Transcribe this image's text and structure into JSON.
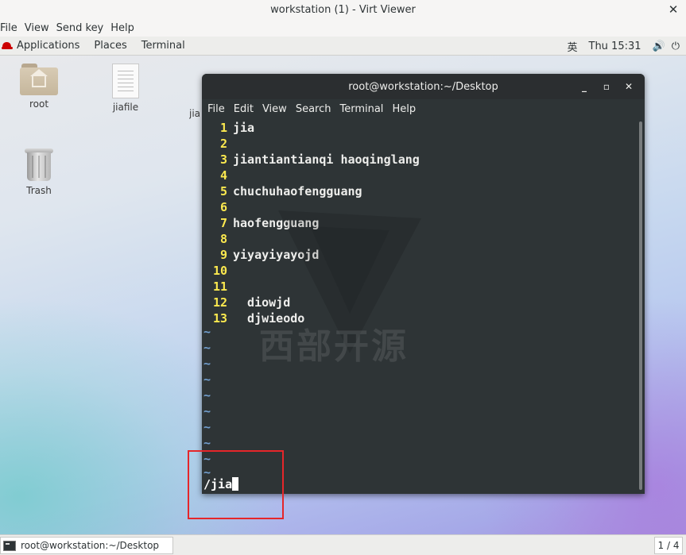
{
  "window": {
    "title": "workstation (1) - Virt Viewer",
    "close_glyph": "✕"
  },
  "viewer_menu": [
    "File",
    "View",
    "Send key",
    "Help"
  ],
  "topbar": {
    "applications": "Applications",
    "places": "Places",
    "terminal": "Terminal",
    "input_method": "英",
    "clock": "Thu 15:31",
    "volume_glyph": "🔊",
    "power_glyph": "⏻"
  },
  "desktop_icons": {
    "root": "root",
    "jiafile": "jiafile",
    "trash": "Trash",
    "partial": "jia"
  },
  "terminal": {
    "title": "root@workstation:~/Desktop",
    "controls": {
      "minimize": "_",
      "maximize": "▫",
      "close": "✕"
    },
    "menu": [
      "File",
      "Edit",
      "View",
      "Search",
      "Terminal",
      "Help"
    ],
    "lines": [
      {
        "num": "1",
        "text": "jia"
      },
      {
        "num": "2",
        "text": ""
      },
      {
        "num": "3",
        "text": "jiantiantianqi haoqinglang"
      },
      {
        "num": "4",
        "text": ""
      },
      {
        "num": "5",
        "text": "chuchuhaofengguang"
      },
      {
        "num": "6",
        "text": ""
      },
      {
        "num": "7",
        "text": "haofengguang"
      },
      {
        "num": "8",
        "text": ""
      },
      {
        "num": "9",
        "text": "yiyayiyayojd"
      },
      {
        "num": "10",
        "text": ""
      },
      {
        "num": "11",
        "text": ""
      },
      {
        "num": "12",
        "text": "  diowjd"
      },
      {
        "num": "13",
        "text": "  djwieodo"
      }
    ],
    "tilde": "~",
    "command": "/jia"
  },
  "watermark": "西部开源",
  "taskbar": {
    "item": "root@workstation:~/Desktop",
    "pager": "1 / 4"
  }
}
